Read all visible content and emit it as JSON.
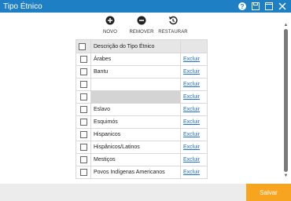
{
  "window": {
    "title": "Tipo Étnico",
    "help_icon": "help-icon",
    "save_window_icon": "save-window-icon",
    "maximize_icon": "maximize-icon",
    "close_icon": "close-icon"
  },
  "toolbar": {
    "new_label": "NOVO",
    "remove_label": "REMOVER",
    "restore_label": "RESTAURAR"
  },
  "grid": {
    "header": "Descrição do Tipo Étnico",
    "action_label": "Excluir",
    "rows": [
      {
        "desc": "Árabes"
      },
      {
        "desc": "Bantu"
      },
      {
        "desc": ""
      },
      {
        "desc": ""
      },
      {
        "desc": "Eslavo"
      },
      {
        "desc": "Esquimós"
      },
      {
        "desc": "Hispanicos"
      },
      {
        "desc": "Hispânicos/Latinos"
      },
      {
        "desc": "Mestiços"
      },
      {
        "desc": "Povos Indígenas Americanos"
      }
    ]
  },
  "footer": {
    "save_label": "Salvar"
  },
  "colors": {
    "titlebar": "#1f7fc4",
    "save_button": "#f7a520",
    "link": "#1a6fd1"
  }
}
